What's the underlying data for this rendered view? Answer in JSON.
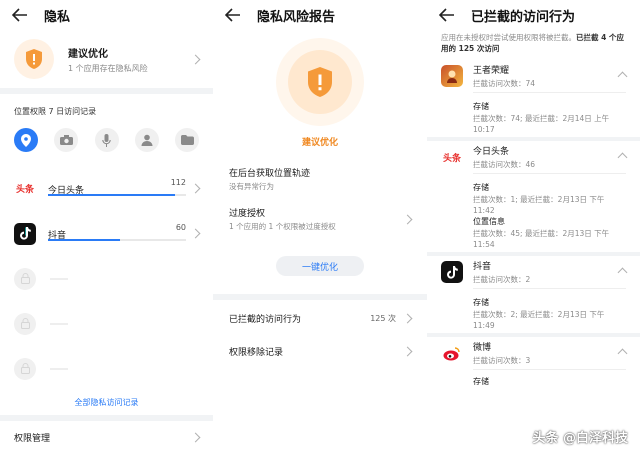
{
  "colors": {
    "accent": "#2a7bf6",
    "warning": "#f08a24",
    "shield": "#f59a3a"
  },
  "privacy": {
    "title": "隐私",
    "suggestion": {
      "title": "建议优化",
      "subtitle": "1 个应用存在隐私风险"
    },
    "location_label": "位置权限 7 日访问记录",
    "permission_icons": [
      "location-icon",
      "camera-icon",
      "microphone-icon",
      "contacts-icon",
      "folder-icon"
    ],
    "apps": [
      {
        "name": "今日头条",
        "count": "112",
        "icon": "头条",
        "progress": 0.92
      },
      {
        "name": "抖音",
        "count": "60",
        "icon": "tiktok-icon",
        "progress": 0.52
      }
    ],
    "all_records_link": "全部隐私访问记录",
    "permission_manage": "权限管理"
  },
  "report": {
    "title": "隐私风险报告",
    "status": "建议优化",
    "items": [
      {
        "title": "在后台获取位置轨迹",
        "subtitle": "没有异常行为"
      },
      {
        "title": "过度授权",
        "subtitle": "1 个应用的 1 个权限被过度授权"
      }
    ],
    "optimize_button": "一键优化",
    "blocked": {
      "label": "已拦截的访问行为",
      "count": "125 次"
    },
    "removal": {
      "label": "权限移除记录"
    }
  },
  "blocked": {
    "title": "已拦截的访问行为",
    "desc_prefix": "应用在未授权时尝试使用权限将被拦截。",
    "desc_bold": "已拦截 4 个应用的 125 次访问",
    "apps": [
      {
        "name": "王者荣耀",
        "sub": "拦截访问次数：74",
        "icon": "game-icon",
        "details": [
          {
            "title": "存储",
            "text": "拦截次数：74; 最近拦截：2月14日 上午 10:17"
          }
        ]
      },
      {
        "name": "今日头条",
        "sub": "拦截访问次数：46",
        "icon": "头条",
        "details": [
          {
            "title": "存储",
            "text": "拦截次数：1; 最近拦截：2月13日 下午 11:42"
          },
          {
            "title": "位置信息",
            "text": "拦截次数：45; 最近拦截：2月13日 下午 11:54"
          }
        ]
      },
      {
        "name": "抖音",
        "sub": "拦截访问次数：2",
        "icon": "tiktok-icon",
        "details": [
          {
            "title": "存储",
            "text": "拦截次数：2; 最近拦截：2月13日 下午 11:49"
          }
        ]
      },
      {
        "name": "微博",
        "sub": "拦截访问次数：3",
        "icon": "weibo-icon",
        "details": [
          {
            "title": "存储",
            "text": ""
          }
        ]
      }
    ]
  },
  "watermark": "头条 @白泽科技"
}
